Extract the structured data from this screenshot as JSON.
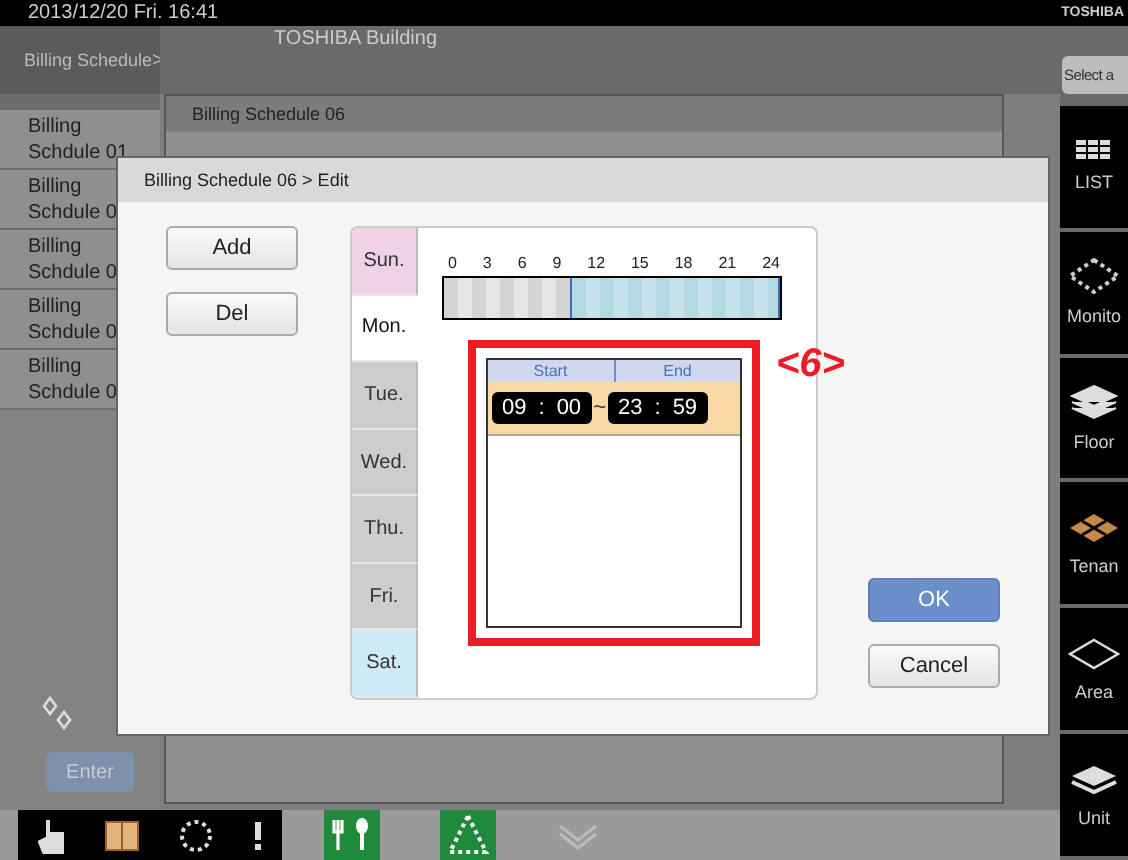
{
  "top_bar": {
    "datetime": "2013/12/20 Fri. 16:41",
    "brand": "TOSHIBA"
  },
  "sidebar": {
    "title": "Billing Schedule",
    "arrow": ">",
    "items": [
      {
        "label": "Billing Schdule 01",
        "selected": false
      },
      {
        "label": "Billing Schdule 0",
        "selected": false
      },
      {
        "label": "Billing Schdule 0",
        "selected": false
      },
      {
        "label": "Billing Schdule 0",
        "selected": false
      },
      {
        "label": "Billing Schdule 0",
        "selected": false
      }
    ],
    "enter_button": {
      "label": "Enter",
      "disabled": true
    }
  },
  "header": {
    "location": "TOSHIBA Building"
  },
  "back_dialog": {
    "title": "Billing Schedule 06"
  },
  "dialog": {
    "title": "Billing Schedule 06 > Edit",
    "side_buttons": [
      "Add",
      "Del"
    ],
    "days": [
      {
        "label": "Sun.",
        "selected": false,
        "color": "#f0d2e6"
      },
      {
        "label": "Mon.",
        "selected": true,
        "color": "#ffffff"
      },
      {
        "label": "Tue.",
        "selected": false,
        "color": "#cdcdcd"
      },
      {
        "label": "Wed.",
        "selected": false,
        "color": "#cdcdcd"
      },
      {
        "label": "Thu.",
        "selected": false,
        "color": "#cdcdcd"
      },
      {
        "label": "Fri.",
        "selected": false,
        "color": "#cdcdcd"
      },
      {
        "label": "Sat.",
        "selected": false,
        "color": "#cfeaf7"
      }
    ],
    "timeline": {
      "ticks": [
        "0",
        "3",
        "6",
        "9",
        "12",
        "15",
        "18",
        "21",
        "24"
      ],
      "level": 0.625
    },
    "periods": {
      "columns": [
        "Start",
        "End"
      ],
      "rows": [
        {
          "start_hour": "09",
          "start_colon": ":",
          "start_minute": "00",
          "separator": "~",
          "end_hour": "23",
          "end_colon": ":",
          "end_minute": "59"
        }
      ]
    },
    "annotation": "<6>",
    "ok": "OK",
    "cancel": "Cancel"
  },
  "right_bar": {
    "select_button": "Select a",
    "items": [
      {
        "label": "LIST",
        "kind": "list"
      },
      {
        "label": "Monito",
        "kind": "monitor"
      },
      {
        "label": "Floor",
        "kind": "floor"
      },
      {
        "label": "Tenan",
        "kind": "tenant"
      },
      {
        "label": "Area",
        "kind": "area"
      },
      {
        "label": "Unit",
        "kind": "unit"
      }
    ]
  }
}
